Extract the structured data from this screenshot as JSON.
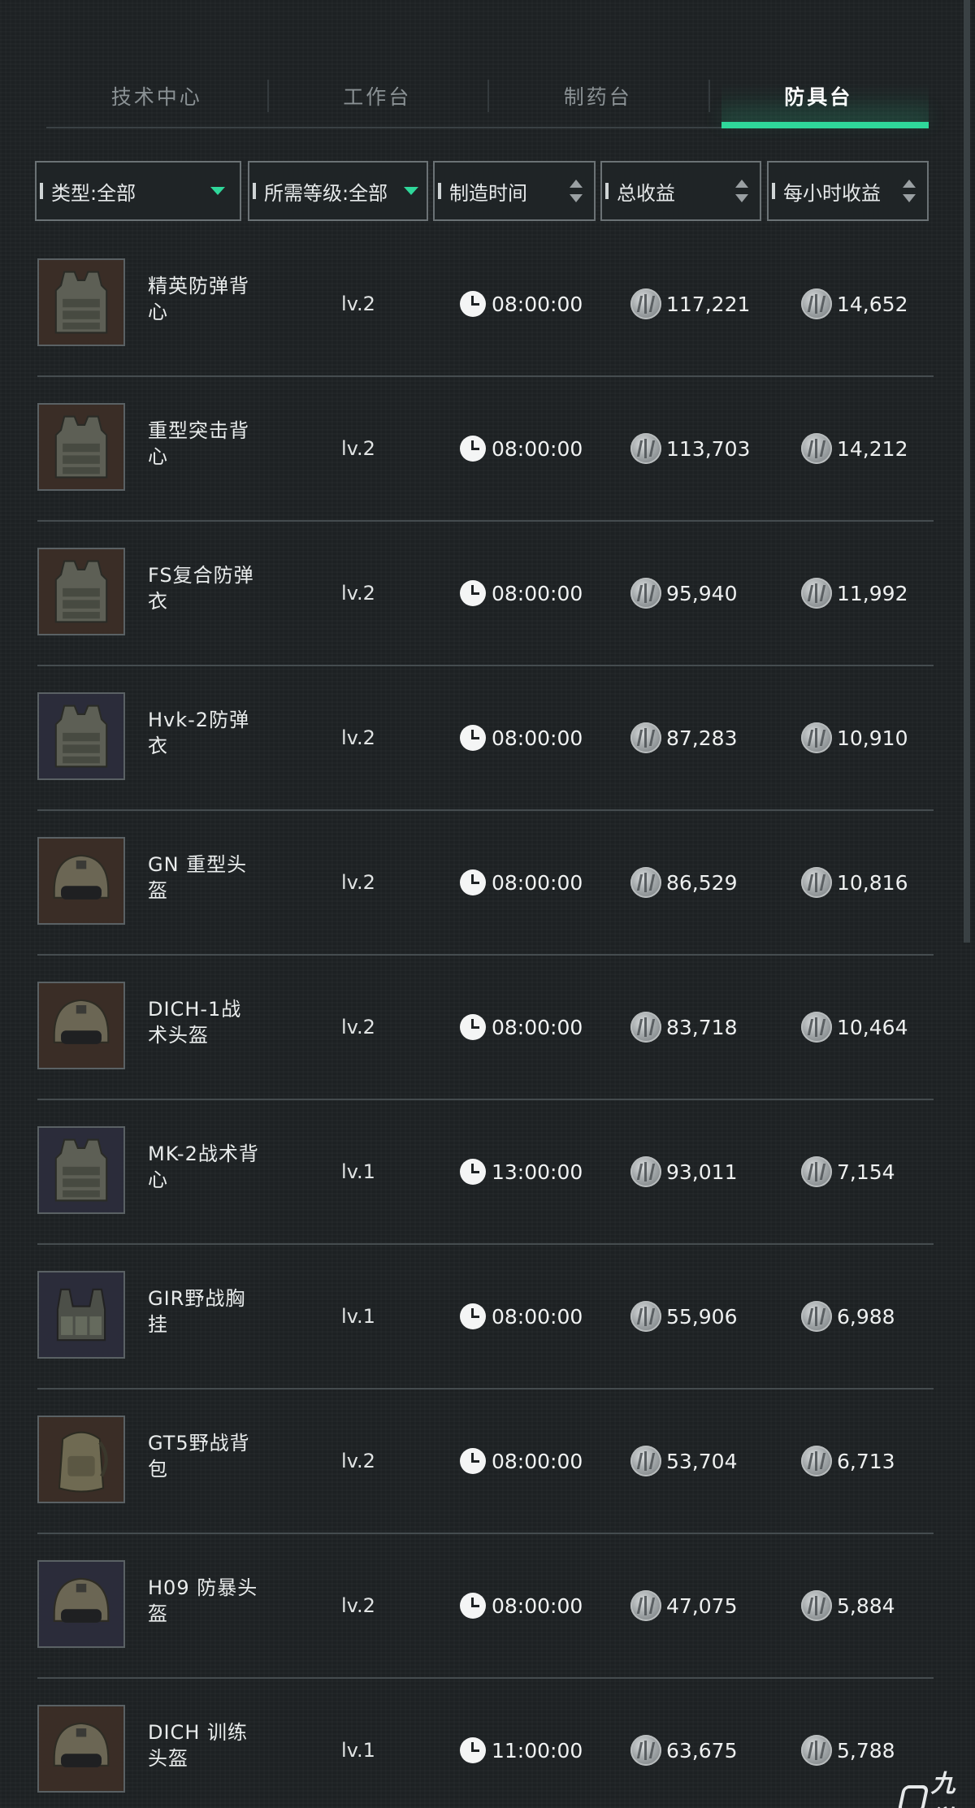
{
  "tabs": [
    {
      "label": "技术中心",
      "active": false
    },
    {
      "label": "工作台",
      "active": false
    },
    {
      "label": "制药台",
      "active": false
    },
    {
      "label": "防具台",
      "active": true
    }
  ],
  "filters": {
    "type": "类型:全部",
    "level": "所需等级:全部",
    "craft_time": "制造时间",
    "total_income": "总收益",
    "hourly_income": "每小时收益"
  },
  "accent_color": "#2fd79a",
  "items": [
    {
      "name": "精英防弹背心",
      "level": "lv.2",
      "time": "08:00:00",
      "total": "117,221",
      "hourly": "14,652",
      "icon": "vest-icon"
    },
    {
      "name": "重型突击背心",
      "level": "lv.2",
      "time": "08:00:00",
      "total": "113,703",
      "hourly": "14,212",
      "icon": "vest-icon"
    },
    {
      "name": "FS复合防弹衣",
      "level": "lv.2",
      "time": "08:00:00",
      "total": "95,940",
      "hourly": "11,992",
      "icon": "vest-icon"
    },
    {
      "name": "Hvk-2防弹衣",
      "level": "lv.2",
      "time": "08:00:00",
      "total": "87,283",
      "hourly": "10,910",
      "icon": "vest-icon"
    },
    {
      "name": "GN 重型头盔",
      "level": "lv.2",
      "time": "08:00:00",
      "total": "86,529",
      "hourly": "10,816",
      "icon": "helmet-icon"
    },
    {
      "name": "DICH-1战术头盔",
      "level": "lv.2",
      "time": "08:00:00",
      "total": "83,718",
      "hourly": "10,464",
      "icon": "helmet-icon"
    },
    {
      "name": "MK-2战术背心",
      "level": "lv.1",
      "time": "13:00:00",
      "total": "93,011",
      "hourly": "7,154",
      "icon": "vest-icon"
    },
    {
      "name": "GIR野战胸挂",
      "level": "lv.1",
      "time": "08:00:00",
      "total": "55,906",
      "hourly": "6,988",
      "icon": "chest-rig-icon"
    },
    {
      "name": "GT5野战背包",
      "level": "lv.2",
      "time": "08:00:00",
      "total": "53,704",
      "hourly": "6,713",
      "icon": "backpack-icon"
    },
    {
      "name": "H09 防暴头盔",
      "level": "lv.2",
      "time": "08:00:00",
      "total": "47,075",
      "hourly": "5,884",
      "icon": "helmet-icon"
    },
    {
      "name": "DICH 训练头盔",
      "level": "lv.1",
      "time": "11:00:00",
      "total": "63,675",
      "hourly": "5,788",
      "icon": "helmet-icon"
    }
  ],
  "watermark": "九游"
}
